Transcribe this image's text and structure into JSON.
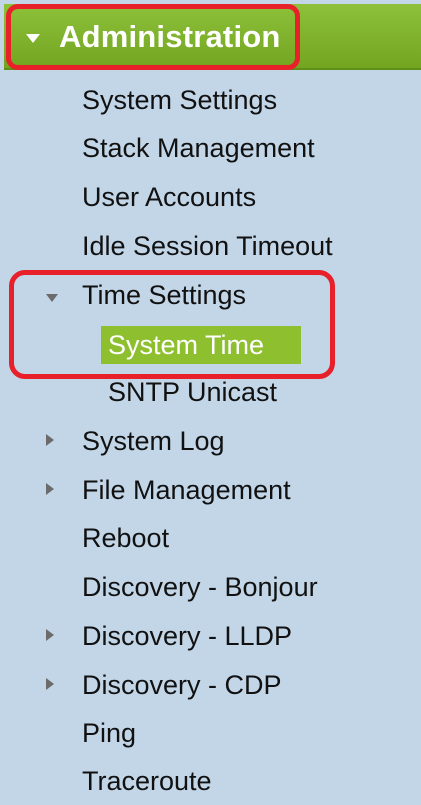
{
  "nav": {
    "header": {
      "label": "Administration",
      "icon": "caret-down-icon",
      "color": "#7fb32d"
    },
    "items": [
      {
        "label": "System Settings"
      },
      {
        "label": "Stack Management"
      },
      {
        "label": "User Accounts"
      },
      {
        "label": "Idle Session Timeout"
      },
      {
        "label": "Time Settings",
        "expanded": true,
        "icon": "caret-down-icon",
        "children": [
          {
            "label": "System Time",
            "selected": true
          },
          {
            "label": "SNTP Unicast"
          }
        ]
      },
      {
        "label": "System Log",
        "expanded": false,
        "icon": "caret-right-icon"
      },
      {
        "label": "File Management",
        "expanded": false,
        "icon": "caret-right-icon"
      },
      {
        "label": "Reboot"
      },
      {
        "label": "Discovery - Bonjour"
      },
      {
        "label": "Discovery - LLDP",
        "expanded": false,
        "icon": "caret-right-icon"
      },
      {
        "label": "Discovery - CDP",
        "expanded": false,
        "icon": "caret-right-icon"
      },
      {
        "label": "Ping"
      },
      {
        "label": "Traceroute"
      }
    ]
  },
  "colors": {
    "nav_background": "#c2d6e8",
    "selected_background": "#8dbf2f",
    "highlight_outline": "#e8202a"
  }
}
